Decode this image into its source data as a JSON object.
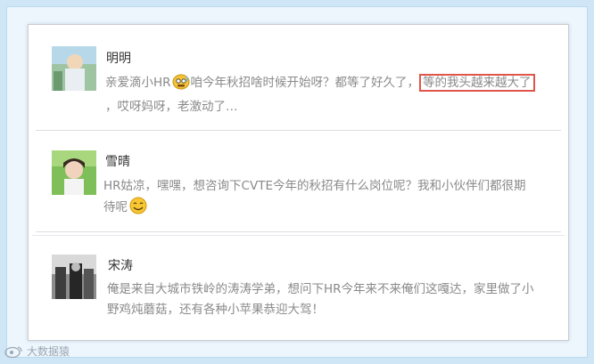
{
  "comments": [
    {
      "name": "明明",
      "line1_before": "亲爱滴小HR",
      "line1_after": "咱今年秋招啥时候开始呀？都等了好久了，",
      "highlight": "等的我头越来越大了",
      "line2": "，哎呀妈呀，老激动了…"
    },
    {
      "name": "雪晴",
      "line1": "HR姑凉，嘿嘿，想咨询下CVTE今年的秋招有什么岗位呢？我和小伙伴们都很期",
      "line2": "待呢"
    },
    {
      "name": "宋涛",
      "line1": "俺是来自大城市铁岭的涛涛学弟，想问下HR今年来不来俺们这嘎达，家里做了小",
      "line2": "野鸡炖蘑菇，还有各种小苹果恭迎大驾！"
    }
  ],
  "watermark": "大数据猿",
  "colors": {
    "highlight_border": "#e0554a",
    "text": "#8a8a8a",
    "name": "#333333"
  },
  "icons": [
    "sweat-emoji-icon",
    "smile-emoji-icon",
    "weibo-icon"
  ]
}
